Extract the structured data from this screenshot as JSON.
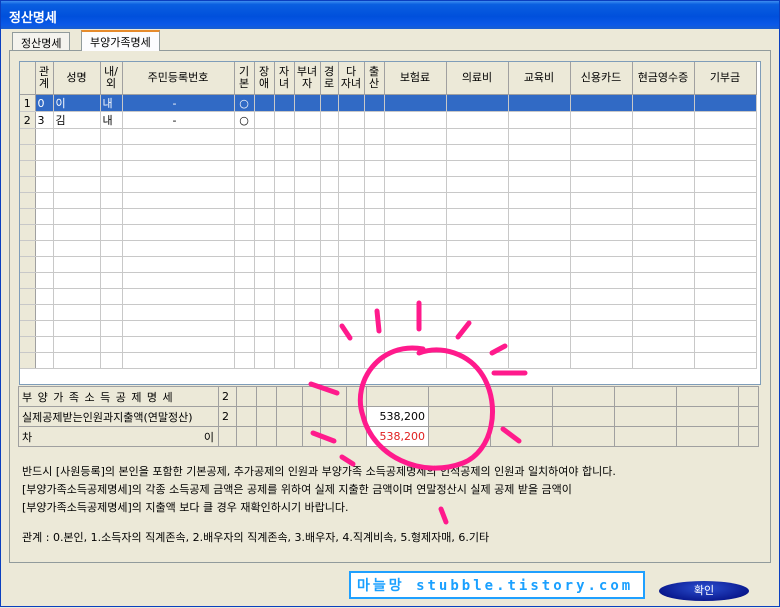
{
  "window": {
    "title": "정산명세"
  },
  "tabs": [
    {
      "label": "정산명세"
    },
    {
      "label": "부양가족명세"
    }
  ],
  "grid": {
    "columns": [
      "관\n계",
      "성명",
      "내/\n외",
      "주민등록번호",
      "기\n본",
      "장\n애",
      "자\n녀",
      "부녀\n자",
      "경\n로",
      "다\n자녀",
      "출\n산",
      "보험료",
      "의료비",
      "교육비",
      "신용카드",
      "현금영수증",
      "기부금"
    ],
    "rows": [
      {
        "num": "1",
        "rel": "0",
        "name": "이",
        "nat": "내",
        "rrn": "-",
        "basic": "○"
      },
      {
        "num": "2",
        "rel": "3",
        "name": "김",
        "nat": "내",
        "rrn": "-",
        "basic": "○"
      }
    ]
  },
  "summary": {
    "row1_label": "부 양 가 족   소 득 공 제  명 세",
    "row1_count": "2",
    "row2_label": "실제공제받는인원과지출액(연말정산)",
    "row2_count": "2",
    "row2_amount": "538,200",
    "row3_label": "차",
    "row3_right": "이",
    "row3_amount": "538,200"
  },
  "notes": {
    "line1": "반드시 [사원등록]의 본인을 포함한 기본공제, 추가공제의 인원과 부양가족 소득공제명세의 인적공제의 인원과 일치하여야 합니다.",
    "line2": "[부양가족소득공제명세]의 각종 소득공제 금액은 공제를 위하여 실제 지출한 금액이며 연말정산시 실제 공제 받을 금액이",
    "line3": "[부양가족소득공제명세]의 지출액 보다 클 경우 재확인하시기 바랍니다.",
    "legend": "관계 : 0.본인, 1.소득자의 직계존속, 2.배우자의 직계존속, 3.배우자, 4.직계비속, 5.형제자매, 6.기타"
  },
  "watermark": "마늘망 stubble.tistory.com",
  "buttons": {
    "ok": "확인"
  },
  "colors": {
    "title_bar": "#0050dc",
    "selection": "#316ac5",
    "diff_amount": "#e02020",
    "annotation": "#ff1a8c",
    "watermark": "#1aa0ff"
  }
}
